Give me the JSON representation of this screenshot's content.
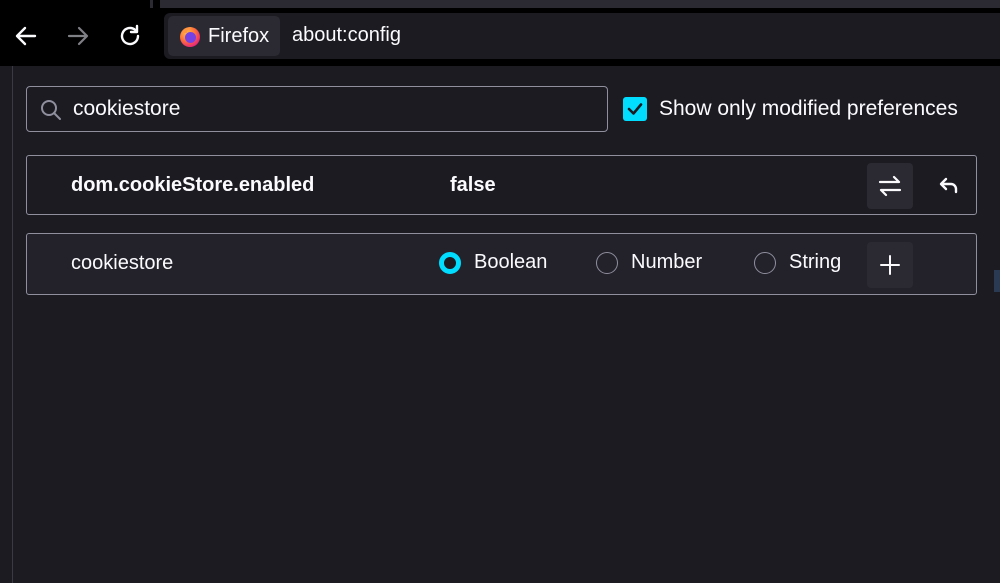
{
  "toolbar": {
    "identity_label": "Firefox",
    "url": "about:config",
    "back_icon": "back-arrow-icon",
    "forward_icon": "forward-arrow-icon",
    "reload_icon": "reload-icon"
  },
  "search": {
    "value": "cookiestore",
    "icon": "search-icon"
  },
  "filter": {
    "checked": true,
    "label": "Show only modified preferences"
  },
  "preferences": [
    {
      "name": "dom.cookieStore.enabled",
      "value": "false",
      "modified": true
    }
  ],
  "new_pref": {
    "name": "cookiestore",
    "types": [
      {
        "label": "Boolean",
        "selected": true
      },
      {
        "label": "Number",
        "selected": false
      },
      {
        "label": "String",
        "selected": false
      }
    ]
  },
  "colors": {
    "accent": "#00ddff",
    "background": "#1c1b22",
    "toolbar": "#000000",
    "border": "#8f8f9d"
  }
}
